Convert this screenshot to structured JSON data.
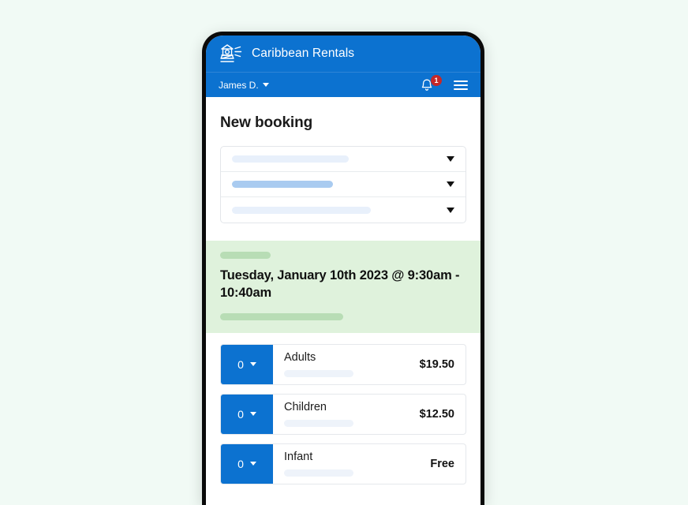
{
  "theme": {
    "page_background": "#f1faf5",
    "brand_blue": "#0c72d0",
    "date_band_green": "#dff2dc",
    "badge_red": "#c62828"
  },
  "app": {
    "logo_icon": "lighthouse-icon",
    "title": "Caribbean Rentals"
  },
  "subbar": {
    "user_label": "James D.",
    "user_caret_icon": "chevron-down-icon",
    "bell_icon": "notification-bell-icon",
    "notification_count": "1",
    "menu_icon": "hamburger-menu-icon"
  },
  "main": {
    "page_title": "New booking",
    "selectors": [
      {
        "name": "location-select",
        "placeholder_style": "pale",
        "placeholder_width": 148,
        "caret_icon": "chevron-down-icon"
      },
      {
        "name": "activity-select",
        "placeholder_style": "solid",
        "placeholder_width": 128,
        "caret_icon": "chevron-down-icon"
      },
      {
        "name": "date-select",
        "placeholder_style": "pale",
        "placeholder_width": 176,
        "caret_icon": "chevron-down-icon"
      }
    ],
    "date_band": {
      "top_skeleton_width": 64,
      "slot_text": "Tuesday, January 10th 2023 @ 9:30am - 10:40am",
      "bottom_skeleton_width": 156
    },
    "ticket_types": [
      {
        "quantity": "0",
        "caret_icon": "chevron-down-icon",
        "name": "Adults",
        "price": "$19.50"
      },
      {
        "quantity": "0",
        "caret_icon": "chevron-down-icon",
        "name": "Children",
        "price": "$12.50"
      },
      {
        "quantity": "0",
        "caret_icon": "chevron-down-icon",
        "name": "Infant",
        "price": "Free"
      }
    ]
  }
}
